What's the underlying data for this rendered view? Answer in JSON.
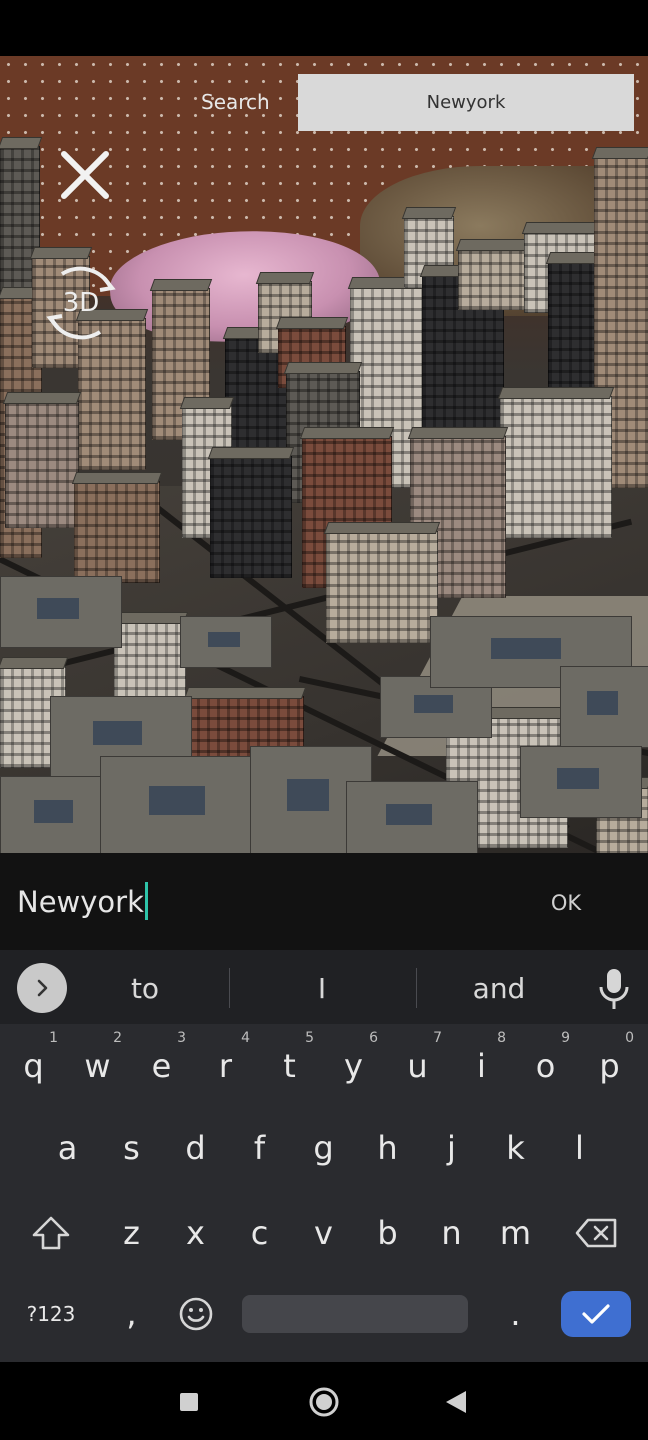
{
  "search": {
    "label": "Search",
    "value": "Newyork"
  },
  "overlay": {
    "close_icon": "close-icon",
    "mode_label": "3D"
  },
  "input": {
    "value": "Newyork",
    "ok_label": "OK"
  },
  "keyboard": {
    "suggestions": [
      "to",
      "I",
      "and"
    ],
    "rows": [
      [
        {
          "char": "q",
          "hint": "1"
        },
        {
          "char": "w",
          "hint": "2"
        },
        {
          "char": "e",
          "hint": "3"
        },
        {
          "char": "r",
          "hint": "4"
        },
        {
          "char": "t",
          "hint": "5"
        },
        {
          "char": "y",
          "hint": "6"
        },
        {
          "char": "u",
          "hint": "7"
        },
        {
          "char": "i",
          "hint": "8"
        },
        {
          "char": "o",
          "hint": "9"
        },
        {
          "char": "p",
          "hint": "0"
        }
      ],
      [
        {
          "char": "a"
        },
        {
          "char": "s"
        },
        {
          "char": "d"
        },
        {
          "char": "f"
        },
        {
          "char": "g"
        },
        {
          "char": "h"
        },
        {
          "char": "j"
        },
        {
          "char": "k"
        },
        {
          "char": "l"
        }
      ],
      [
        {
          "char": "z"
        },
        {
          "char": "x"
        },
        {
          "char": "c"
        },
        {
          "char": "v"
        },
        {
          "char": "b"
        },
        {
          "char": "n"
        },
        {
          "char": "m"
        }
      ]
    ],
    "symbols_label": "?123",
    "comma": ",",
    "period": ".",
    "icons": {
      "expand": "chevron-right-icon",
      "mic": "mic-icon",
      "shift": "shift-icon",
      "backspace": "backspace-icon",
      "emoji": "emoji-icon",
      "enter": "check-icon"
    },
    "accent_color": "#3f6fd1"
  },
  "nav": {
    "icons": [
      "recents-icon",
      "home-icon",
      "back-icon"
    ]
  }
}
